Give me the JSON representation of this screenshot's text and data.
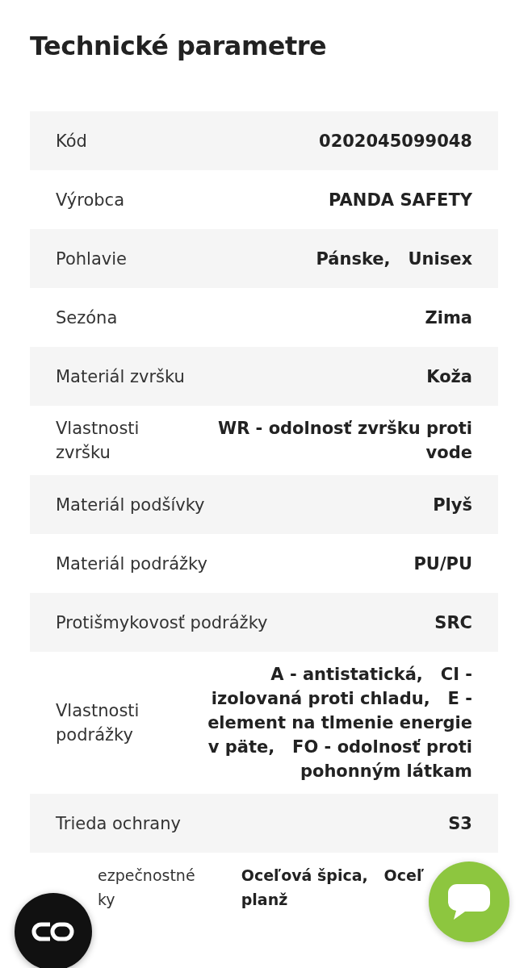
{
  "title": "Technické parametre",
  "rows": [
    {
      "kind": "full",
      "label": "Kód",
      "values": [
        "0202045099048"
      ]
    },
    {
      "kind": "full",
      "label": "Výrobca",
      "values": [
        "PANDA SAFETY"
      ]
    },
    {
      "kind": "full",
      "label": "Pohlavie",
      "values": [
        "Pánske,",
        "Unisex"
      ]
    },
    {
      "kind": "full",
      "label": "Sezóna",
      "values": [
        "Zima"
      ]
    },
    {
      "kind": "full",
      "label": "Materiál zvršku",
      "values": [
        "Koža"
      ]
    },
    {
      "kind": "full",
      "label": "Vlastnosti zvršku",
      "values": [
        "WR - odolnosť zvršku proti vode"
      ]
    },
    {
      "kind": "full",
      "label": "Materiál podšívky",
      "values": [
        "Plyš"
      ]
    },
    {
      "kind": "full",
      "label": "Materiál podrážky",
      "values": [
        "PU/PU"
      ]
    },
    {
      "kind": "full",
      "label": "Protišmykovosť podrážky",
      "values": [
        "SRC"
      ]
    },
    {
      "kind": "full",
      "label": "Vlastnosti podrážky",
      "values": [
        "A - antistatická,",
        "CI - izolovaná proti chladu,",
        "E - element na tlmenie energie v päte,",
        "FO - odolnosť proti pohonným látkam"
      ]
    },
    {
      "kind": "full",
      "label": "Trieda ochrany",
      "values": [
        "S3"
      ]
    },
    {
      "kind": "cut",
      "label": "ezpečnostné\nky",
      "values": [
        "Oceľová špica,",
        "Oceľ\nplanž"
      ]
    }
  ]
}
